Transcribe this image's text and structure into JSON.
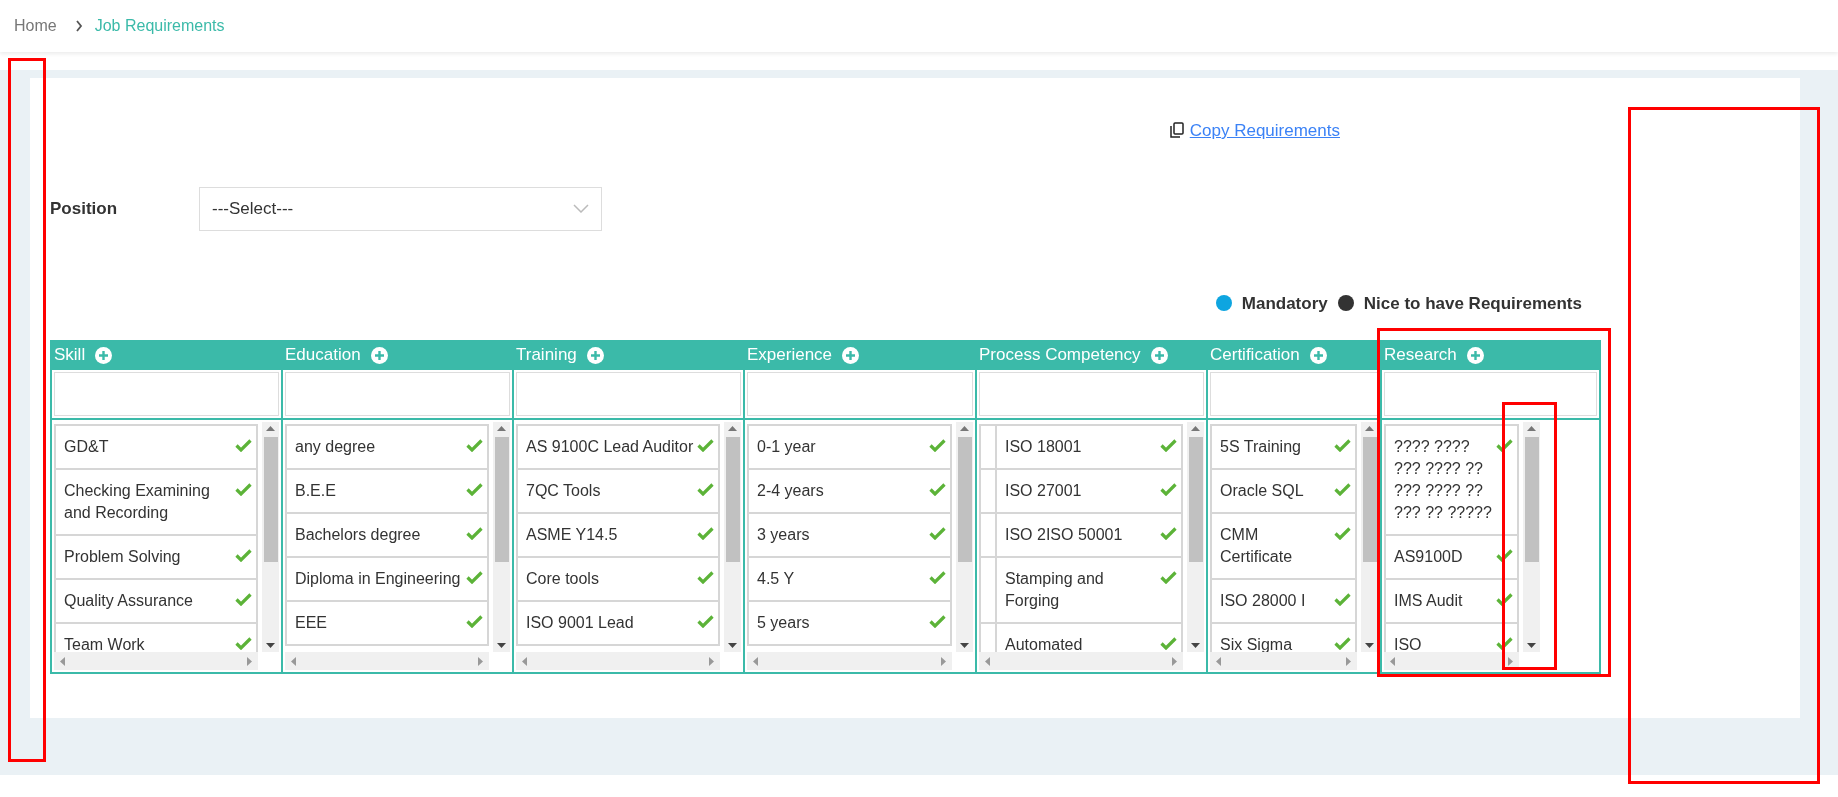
{
  "breadcrumb": [
    {
      "label": "Home",
      "current": false
    },
    {
      "label": "Job Requirements",
      "current": true
    }
  ],
  "copy_link": "Copy Requirements",
  "position": {
    "label": "Position",
    "value": "---Select---"
  },
  "legend": [
    {
      "label": "Mandatory",
      "color": "#0ea5e0"
    },
    {
      "label": "Nice to have Requirements",
      "color": "#333333"
    }
  ],
  "columns": [
    {
      "title": "Skill",
      "kind": "plain",
      "items": [
        "GD&T",
        "Checking Examining and Recording",
        "Problem Solving",
        "Quality Assurance",
        "Team Work"
      ]
    },
    {
      "title": "Education",
      "kind": "plain",
      "items": [
        "any degree",
        "B.E.E",
        "Bachelors degree",
        "Diploma in Engineering",
        "EEE"
      ]
    },
    {
      "title": "Training",
      "kind": "plain",
      "items": [
        "AS 9100C Lead Auditor",
        "7QC Tools",
        "ASME Y14.5",
        "Core tools",
        "ISO 9001 Lead"
      ]
    },
    {
      "title": "Experience",
      "kind": "plain",
      "items": [
        "0-1 year",
        "2-4 years",
        "3 years",
        "4.5 Y",
        "5 years"
      ]
    },
    {
      "title": "Process Competency",
      "kind": "indented",
      "items": [
        "ISO 18001",
        "ISO 27001",
        "ISO 2ISO 50001",
        "Stamping and Forging",
        "Automated"
      ]
    },
    {
      "title": "Certification",
      "kind": "plain",
      "items": [
        "5S Training",
        "Oracle SQL",
        "CMM Certificate",
        "ISO 28000 I",
        "Six Sigma"
      ]
    },
    {
      "title": "Research",
      "kind": "plain",
      "items": [
        "???? ???? ??? ???? ?? ??? ???? ?? ??? ?? ?????",
        "AS9100D",
        "IMS Audit",
        "ISO"
      ]
    }
  ]
}
